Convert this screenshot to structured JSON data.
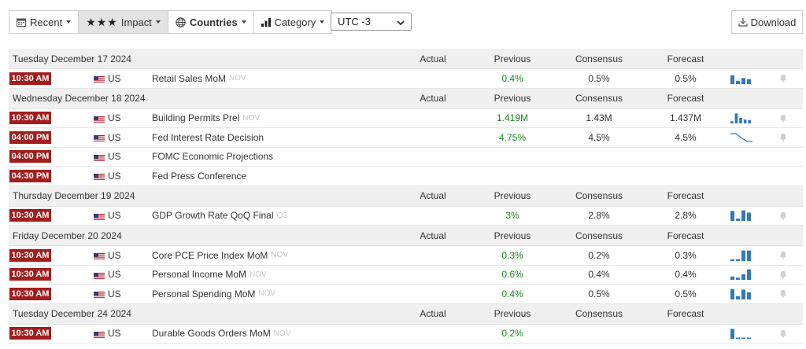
{
  "toolbar": {
    "recent": "Recent",
    "impact": "Impact",
    "countries": "Countries",
    "category": "Category",
    "timezone": "UTC -3",
    "download": "Download"
  },
  "columns": {
    "actual": "Actual",
    "previous": "Previous",
    "consensus": "Consensus",
    "forecast": "Forecast"
  },
  "days": [
    {
      "date": "Tuesday December 17 2024",
      "events": [
        {
          "time": "10:30 AM",
          "country": "US",
          "event": "Retail Sales MoM",
          "ref": "NOV",
          "actual": "",
          "previous": "0.4%",
          "consensus": "0.5%",
          "forecast": "0.5%",
          "spark": "bars",
          "spark_values": [
            0.8,
            0.3,
            0.55,
            0.45
          ]
        }
      ]
    },
    {
      "date": "Wednesday December 18 2024",
      "events": [
        {
          "time": "10:30 AM",
          "country": "US",
          "event": "Building Permits Prel",
          "ref": "NOV",
          "actual": "",
          "previous": "1.419M",
          "consensus": "1.43M",
          "forecast": "1.437M",
          "spark": "bars",
          "spark_values": [
            0.2,
            0.9,
            0.5,
            0.35,
            0.3
          ]
        },
        {
          "time": "04:00 PM",
          "country": "US",
          "event": "Fed Interest Rate Decision",
          "ref": "",
          "actual": "",
          "previous": "4.75%",
          "consensus": "4.5%",
          "forecast": "4.5%",
          "spark": "step",
          "spark_values": [
            1.0,
            1.0,
            0.5,
            0.1,
            0.1
          ]
        },
        {
          "time": "04:00 PM",
          "country": "US",
          "event": "FOMC Economic Projections",
          "ref": "",
          "actual": "",
          "previous": "",
          "consensus": "",
          "forecast": "",
          "spark": "none",
          "spark_values": []
        },
        {
          "time": "04:30 PM",
          "country": "US",
          "event": "Fed Press Conference",
          "ref": "",
          "actual": "",
          "previous": "",
          "consensus": "",
          "forecast": "",
          "spark": "none",
          "spark_values": []
        }
      ]
    },
    {
      "date": "Thursday December 19 2024",
      "events": [
        {
          "time": "10:30 AM",
          "country": "US",
          "event": "GDP Growth Rate QoQ Final",
          "ref": "Q3",
          "actual": "",
          "previous": "3%",
          "consensus": "2.8%",
          "forecast": "2.8%",
          "spark": "bars",
          "spark_values": [
            0.9,
            0.2,
            0.95,
            0.75
          ]
        }
      ]
    },
    {
      "date": "Friday December 20 2024",
      "events": [
        {
          "time": "10:30 AM",
          "country": "US",
          "event": "Core PCE Price Index MoM",
          "ref": "NOV",
          "actual": "",
          "previous": "0.3%",
          "consensus": "0.2%",
          "forecast": "0.3%",
          "spark": "bars",
          "spark_values": [
            0.15,
            0.15,
            0.95,
            0.95
          ]
        },
        {
          "time": "10:30 AM",
          "country": "US",
          "event": "Personal Income MoM",
          "ref": "NOV",
          "actual": "",
          "previous": "0.6%",
          "consensus": "0.4%",
          "forecast": "0.4%",
          "spark": "bars",
          "spark_values": [
            0.3,
            0.2,
            0.5,
            0.95
          ]
        },
        {
          "time": "10:30 AM",
          "country": "US",
          "event": "Personal Spending MoM",
          "ref": "NOV",
          "actual": "",
          "previous": "0.4%",
          "consensus": "0.5%",
          "forecast": "0.5%",
          "spark": "bars",
          "spark_values": [
            0.95,
            0.3,
            0.9,
            0.65
          ]
        }
      ]
    },
    {
      "date": "Tuesday December 24 2024",
      "events": [
        {
          "time": "10:30 AM",
          "country": "US",
          "event": "Durable Goods Orders MoM",
          "ref": "NOV",
          "actual": "",
          "previous": "0.2%",
          "consensus": "",
          "forecast": "",
          "spark": "bars",
          "spark_values": [
            0.9,
            0.1,
            0.1,
            0.05
          ]
        }
      ]
    }
  ],
  "colors": {
    "time_badge": "#a31d1d",
    "positive": "#1a8a1a",
    "spark": "#2f7bbf",
    "header_bg": "#f0f0f0"
  }
}
